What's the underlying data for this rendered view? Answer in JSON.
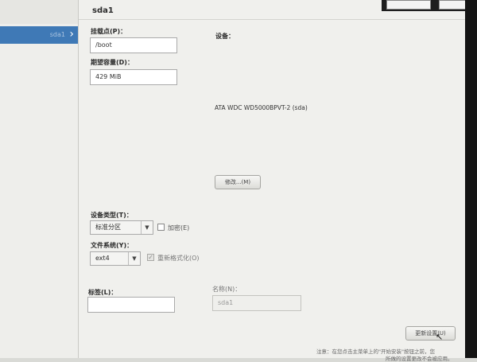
{
  "sidebar": {
    "selected_item": "sda1"
  },
  "topbar": {
    "right_item": "..."
  },
  "partition": {
    "title": "sda1",
    "mount_point_label": "挂载点(P)：",
    "mount_point_value": "/boot",
    "capacity_label": "期望容量(D)：",
    "capacity_value": "429 MiB",
    "devices_label": "设备：",
    "device_name": "ATA WDC WD5000BPVT-2 (sda)",
    "modify_button": "修改...(M)",
    "device_type_label": "设备类型(T)：",
    "device_type_value": "标准分区",
    "encrypt_label": "加密(E)",
    "encrypt_checked": false,
    "filesystem_label": "文件系统(Y)：",
    "filesystem_value": "ext4",
    "reformat_label": "重新格式化(O)",
    "reformat_checked": true,
    "tag_label": "标签(L)：",
    "tag_value": "",
    "name_label": "名称(N)：",
    "name_value": "sda1",
    "update_button": "更新设置(U)",
    "note_line1": "注意：在您点击主菜单上的\"开始安装\"按钮之前，您",
    "note_line2": "所做的设置更改不会被应用。"
  },
  "icons": {
    "selected_chevron": "chevron-right-icon",
    "dropdown_arrow": "chevron-down-icon",
    "check_mark": "check-icon"
  }
}
